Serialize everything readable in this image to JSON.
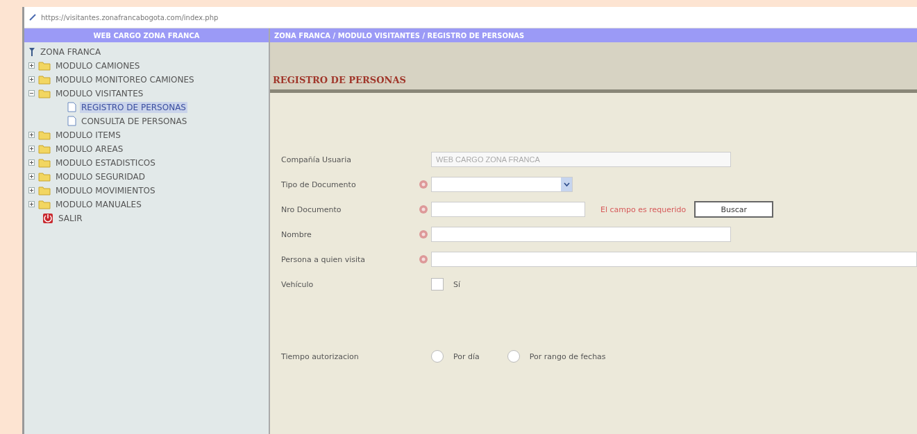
{
  "address_bar": {
    "url": "https://visitantes.zonafrancabogota.com/index.php"
  },
  "sidebar": {
    "header": "WEB CARGO ZONA FRANCA",
    "root": "ZONA FRANCA",
    "items": [
      {
        "kind": "folder",
        "label": "MODULO CAMIONES",
        "expanded": false,
        "selected": false
      },
      {
        "kind": "folder",
        "label": "MODULO MONITOREO CAMIONES",
        "expanded": false,
        "selected": false
      },
      {
        "kind": "folder",
        "label": "MODULO VISITANTES",
        "expanded": true,
        "selected": false,
        "children": [
          {
            "label": "REGISTRO DE PERSONAS",
            "selected": true
          },
          {
            "label": "CONSULTA DE PERSONAS",
            "selected": false
          }
        ]
      },
      {
        "kind": "folder",
        "label": "MODULO ITEMS",
        "expanded": false,
        "selected": false
      },
      {
        "kind": "folder",
        "label": "MODULO AREAS",
        "expanded": false,
        "selected": false
      },
      {
        "kind": "folder",
        "label": "MODULO ESTADISTICOS",
        "expanded": false,
        "selected": false
      },
      {
        "kind": "folder",
        "label": "MODULO SEGURIDAD",
        "expanded": false,
        "selected": false
      },
      {
        "kind": "folder",
        "label": "MODULO MOVIMIENTOS",
        "expanded": false,
        "selected": false
      },
      {
        "kind": "folder",
        "label": "MODULO MANUALES",
        "expanded": false,
        "selected": false
      },
      {
        "kind": "exit",
        "label": "SALIR",
        "selected": false
      }
    ]
  },
  "breadcrumb": "ZONA FRANCA / MODULO VISITANTES / REGISTRO DE PERSONAS",
  "page_title": "REGISTRO DE PERSONAS",
  "form": [
    {
      "kind": "text",
      "label": "Compañía Usuaria",
      "required": false,
      "value": "WEB CARGO ZONA FRANCA",
      "disabled": true
    },
    {
      "kind": "select",
      "label": "Tipo de Documento",
      "required": true
    },
    {
      "kind": "search",
      "label": "Nro Documento",
      "required": true,
      "error": "El campo es requerido",
      "button": "Buscar"
    },
    {
      "kind": "text",
      "label": "Nombre",
      "required": true,
      "disabled": false
    },
    {
      "kind": "longtext",
      "label": "Persona a quien visita",
      "required": true,
      "disabled": false
    },
    {
      "kind": "checkbox",
      "label": "Vehículo",
      "required": false,
      "option": "Sí",
      "checked": false
    },
    {
      "kind": "radio",
      "label": "Tiempo autorizacion",
      "required": false,
      "options": [
        {
          "label": "Por día",
          "selected": false
        },
        {
          "label": "Por rango de fechas",
          "selected": false
        }
      ]
    }
  ]
}
